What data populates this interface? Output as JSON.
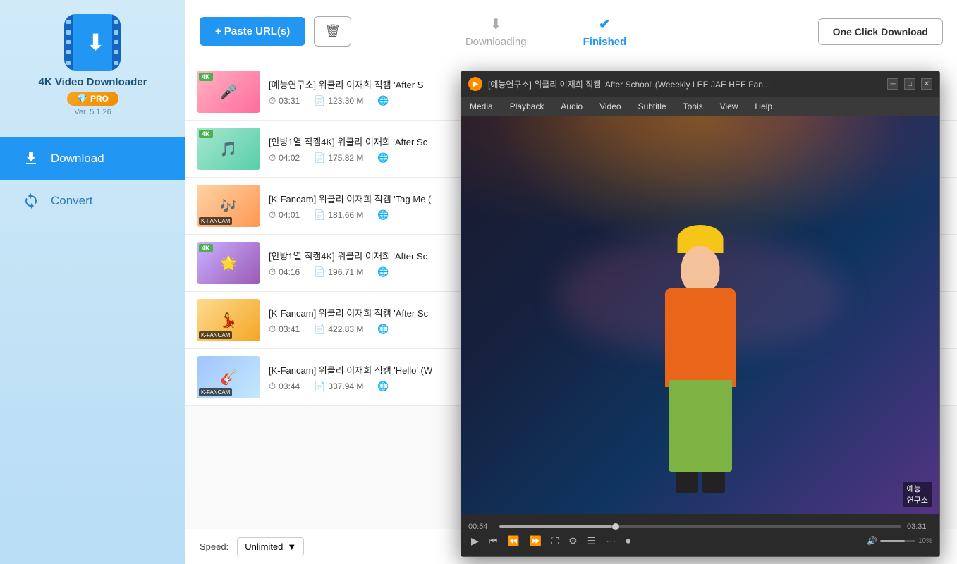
{
  "app": {
    "name": "4K Video Downloader",
    "version": "Ver. 5.1.26",
    "pro_label": "PRO"
  },
  "sidebar": {
    "nav_items": [
      {
        "id": "download",
        "label": "Download",
        "active": true
      },
      {
        "id": "convert",
        "label": "Convert",
        "active": false
      }
    ]
  },
  "toolbar": {
    "paste_btn": "+ Paste URL(s)",
    "one_click_btn": "One Click Download"
  },
  "tabs": {
    "downloading": {
      "label": "Downloading",
      "active": false
    },
    "finished": {
      "label": "Finished",
      "active": true
    }
  },
  "videos": [
    {
      "title": "[예능연구소] 위클리 이재희 직캠 'After S",
      "duration": "03:31",
      "size": "123.30 M",
      "thumb_class": "thumb1",
      "badge": "4K"
    },
    {
      "title": "[안방1열 직캠4K] 위클리 이재희 'After Sc",
      "duration": "04:02",
      "size": "175.82 M",
      "thumb_class": "thumb2",
      "badge": "4K"
    },
    {
      "title": "[K-Fancam] 위클리 이재희 직캠 'Tag Me (",
      "duration": "04:01",
      "size": "181.66 M",
      "thumb_class": "thumb3",
      "badge": ""
    },
    {
      "title": "[안방1열 직캠4K] 위클리 이재희 'After Sc",
      "duration": "04:16",
      "size": "196.71 M",
      "thumb_class": "thumb4",
      "badge": "4K"
    },
    {
      "title": "[K-Fancam] 위클리 이재희 직캠 'After Sc",
      "duration": "03:41",
      "size": "422.83 M",
      "thumb_class": "thumb5",
      "badge": ""
    },
    {
      "title": "[K-Fancam] 위클리 이재희 직캠 'Hello' (W",
      "duration": "03:44",
      "size": "337.94 M",
      "thumb_class": "thumb6",
      "badge": ""
    }
  ],
  "bottom_bar": {
    "speed_label": "Speed:",
    "speed_value": "Unlimited"
  },
  "vlc": {
    "title": "[예능연구소] 위클리 이재희 직캠 'After School' (Weeekly LEE JAE HEE Fan...",
    "menu_items": [
      "Media",
      "Playback",
      "Audio",
      "Video",
      "Subtitle",
      "Tools",
      "View",
      "Help"
    ],
    "time_current": "00:54",
    "time_total": "03:31",
    "seek_percent": 28,
    "volume_percent": "10%",
    "watermark": "예능\n연구소"
  }
}
